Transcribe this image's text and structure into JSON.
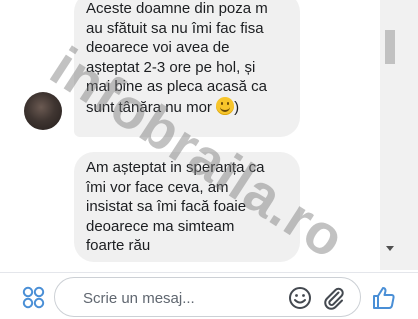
{
  "messages": [
    {
      "text_lines": [
        "Aceste doamne din poza m",
        "au sfătuit sa nu îmi fac fisa",
        "deoarece voi avea de",
        "așteptat 2-3 ore pe hol, și",
        "mai bine as pleca acasă ca"
      ],
      "last_line": "sunt tânăra nu mor ",
      "emoji": "smile-emoji",
      "after_emoji": ")"
    },
    {
      "text": "Am așteptat in speranța ca\nîmi vor face ceva, am\ninsistat sa îmi facă foaie\ndeoarece ma simteam\nfoarte rău"
    }
  ],
  "watermark": "infobraila.ro",
  "composer": {
    "placeholder": "Scrie un mesaj..."
  },
  "icons": {
    "apps": "apps-grid-icon",
    "emoji": "emoji-icon",
    "attach": "paperclip-icon",
    "like": "thumbs-up-icon"
  },
  "colors": {
    "bubble_bg": "#f0f0f0",
    "icon_blue": "#4a8fd6"
  }
}
